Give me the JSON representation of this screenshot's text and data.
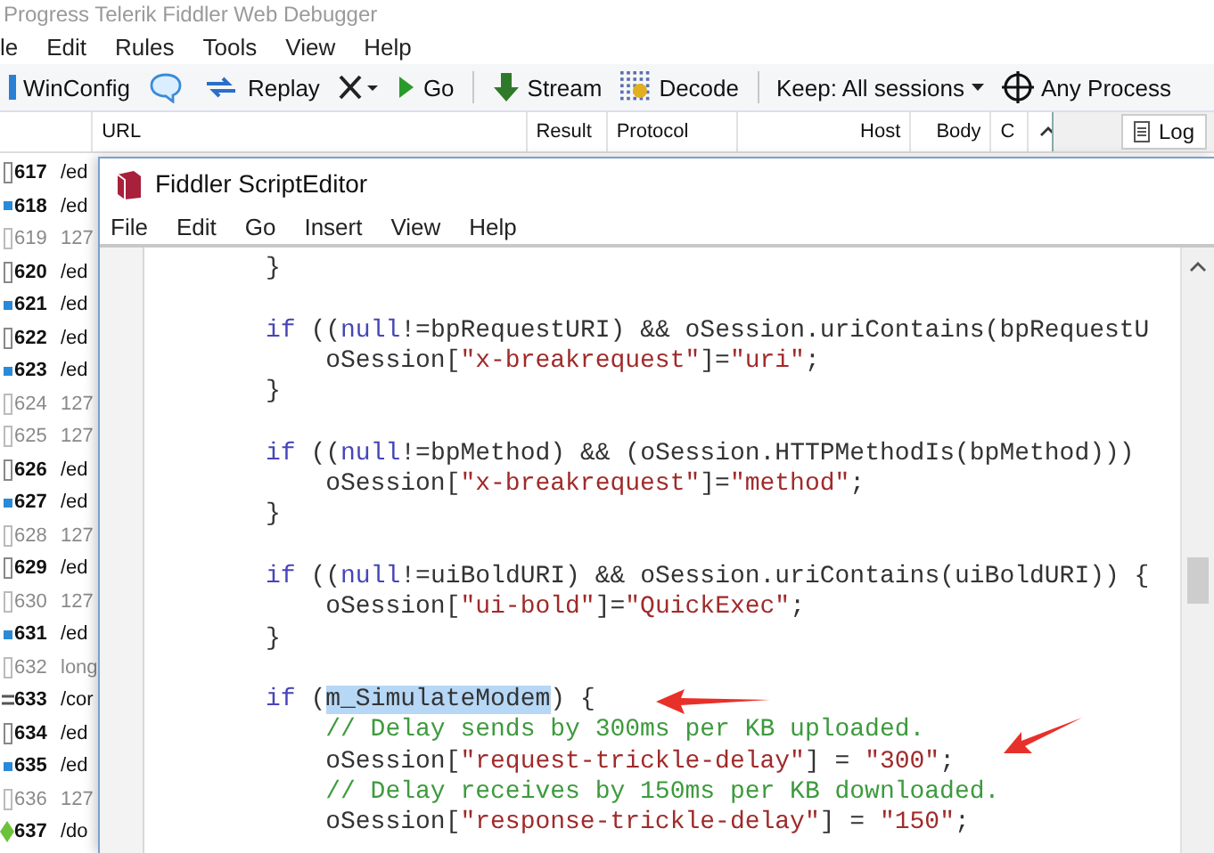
{
  "main_window": {
    "title": "Progress Telerik Fiddler Web Debugger",
    "menu": [
      "le",
      "Edit",
      "Rules",
      "Tools",
      "View",
      "Help"
    ],
    "toolbar": [
      {
        "kind": "button",
        "label": "WinConfig"
      },
      {
        "kind": "icon_button"
      },
      {
        "kind": "button",
        "label": "Replay"
      },
      {
        "kind": "menu_button"
      },
      {
        "kind": "button",
        "label": "Go"
      },
      {
        "kind": "separator"
      },
      {
        "kind": "button",
        "label": "Stream"
      },
      {
        "kind": "button",
        "label": "Decode"
      },
      {
        "kind": "separator"
      },
      {
        "kind": "menu_button",
        "label": "Keep: All sessions"
      },
      {
        "kind": "button",
        "label": "Any Process"
      }
    ],
    "columns": [
      "URL",
      "Result",
      "Protocol",
      "Host",
      "Body",
      "C"
    ],
    "side_tab": "Log",
    "sessions": [
      {
        "number": "617",
        "url": "/ed",
        "kind": "page"
      },
      {
        "number": "618",
        "url": "/ed",
        "kind": "request"
      },
      {
        "number": "619",
        "url": "127",
        "kind": "tunnel"
      },
      {
        "number": "620",
        "url": "/ed",
        "kind": "page"
      },
      {
        "number": "621",
        "url": "/ed",
        "kind": "request"
      },
      {
        "number": "622",
        "url": "/ed",
        "kind": "page"
      },
      {
        "number": "623",
        "url": "/ed",
        "kind": "request"
      },
      {
        "number": "624",
        "url": "127",
        "kind": "tunnel"
      },
      {
        "number": "625",
        "url": "127",
        "kind": "tunnel"
      },
      {
        "number": "626",
        "url": "/ed",
        "kind": "page"
      },
      {
        "number": "627",
        "url": "/ed",
        "kind": "request"
      },
      {
        "number": "628",
        "url": "127",
        "kind": "tunnel"
      },
      {
        "number": "629",
        "url": "/ed",
        "kind": "page"
      },
      {
        "number": "630",
        "url": "127",
        "kind": "tunnel"
      },
      {
        "number": "631",
        "url": "/ed",
        "kind": "request"
      },
      {
        "number": "632",
        "url": "long",
        "kind": "tunnel"
      },
      {
        "number": "633",
        "url": "/cor",
        "kind": "other"
      },
      {
        "number": "634",
        "url": "/ed",
        "kind": "page"
      },
      {
        "number": "635",
        "url": "/ed",
        "kind": "request"
      },
      {
        "number": "636",
        "url": "127",
        "kind": "tunnel"
      },
      {
        "number": "637",
        "url": "/do",
        "kind": "download"
      }
    ]
  },
  "script_editor": {
    "title": "Fiddler ScriptEditor",
    "menu": [
      "File",
      "Edit",
      "Go",
      "Insert",
      "View",
      "Help"
    ],
    "code": [
      {
        "kind": "code",
        "tokens": [
          {
            "text": "}",
            "kind": "plain"
          }
        ]
      },
      {
        "kind": "blank"
      },
      {
        "kind": "code",
        "tokens": [
          {
            "text": "if",
            "kind": "keyword"
          },
          {
            "text": " ((",
            "kind": "plain"
          },
          {
            "text": "null",
            "kind": "keyword"
          },
          {
            "text": "!=bpRequestURI) && oSession.uriContains(bpRequestU",
            "kind": "plain"
          }
        ]
      },
      {
        "kind": "code",
        "tokens": [
          {
            "text": "    oSession[",
            "kind": "plain"
          },
          {
            "text": "\"x-breakrequest\"",
            "kind": "string"
          },
          {
            "text": "]=",
            "kind": "plain"
          },
          {
            "text": "\"uri\"",
            "kind": "string"
          },
          {
            "text": ";",
            "kind": "plain"
          }
        ]
      },
      {
        "kind": "code",
        "tokens": [
          {
            "text": "}",
            "kind": "plain"
          }
        ]
      },
      {
        "kind": "blank"
      },
      {
        "kind": "code",
        "tokens": [
          {
            "text": "if",
            "kind": "keyword"
          },
          {
            "text": " ((",
            "kind": "plain"
          },
          {
            "text": "null",
            "kind": "keyword"
          },
          {
            "text": "!=bpMethod) && (oSession.HTTPMethodIs(bpMethod)))",
            "kind": "plain"
          }
        ]
      },
      {
        "kind": "code",
        "tokens": [
          {
            "text": "    oSession[",
            "kind": "plain"
          },
          {
            "text": "\"x-breakrequest\"",
            "kind": "string"
          },
          {
            "text": "]=",
            "kind": "plain"
          },
          {
            "text": "\"method\"",
            "kind": "string"
          },
          {
            "text": ";",
            "kind": "plain"
          }
        ]
      },
      {
        "kind": "code",
        "tokens": [
          {
            "text": "}",
            "kind": "plain"
          }
        ]
      },
      {
        "kind": "blank"
      },
      {
        "kind": "code",
        "tokens": [
          {
            "text": "if",
            "kind": "keyword"
          },
          {
            "text": " ((",
            "kind": "plain"
          },
          {
            "text": "null",
            "kind": "keyword"
          },
          {
            "text": "!=uiBoldURI) && oSession.uriContains(uiBoldURI)) {",
            "kind": "plain"
          }
        ]
      },
      {
        "kind": "code",
        "tokens": [
          {
            "text": "    oSession[",
            "kind": "plain"
          },
          {
            "text": "\"ui-bold\"",
            "kind": "string"
          },
          {
            "text": "]=",
            "kind": "plain"
          },
          {
            "text": "\"QuickExec\"",
            "kind": "string"
          },
          {
            "text": ";",
            "kind": "plain"
          }
        ]
      },
      {
        "kind": "code",
        "tokens": [
          {
            "text": "}",
            "kind": "plain"
          }
        ]
      },
      {
        "kind": "blank"
      },
      {
        "kind": "code",
        "tokens": [
          {
            "text": "if",
            "kind": "keyword"
          },
          {
            "text": " (",
            "kind": "plain"
          },
          {
            "text": "m_SimulateModem",
            "kind": "selected"
          },
          {
            "text": ") {",
            "kind": "plain"
          }
        ]
      },
      {
        "kind": "code",
        "tokens": [
          {
            "text": "    // Delay sends by 300ms per KB uploaded.",
            "kind": "comment"
          }
        ]
      },
      {
        "kind": "code",
        "tokens": [
          {
            "text": "    oSession[",
            "kind": "plain"
          },
          {
            "text": "\"request-trickle-delay\"",
            "kind": "string"
          },
          {
            "text": "] = ",
            "kind": "plain"
          },
          {
            "text": "\"300\"",
            "kind": "string"
          },
          {
            "text": ";",
            "kind": "plain"
          }
        ]
      },
      {
        "kind": "code",
        "tokens": [
          {
            "text": "    // Delay receives by 150ms per KB downloaded.",
            "kind": "comment"
          }
        ]
      },
      {
        "kind": "code",
        "tokens": [
          {
            "text": "    oSession[",
            "kind": "plain"
          },
          {
            "text": "\"response-trickle-delay\"",
            "kind": "string"
          },
          {
            "text": "] = ",
            "kind": "plain"
          },
          {
            "text": "\"150\"",
            "kind": "string"
          },
          {
            "text": ";",
            "kind": "plain"
          }
        ]
      }
    ]
  }
}
